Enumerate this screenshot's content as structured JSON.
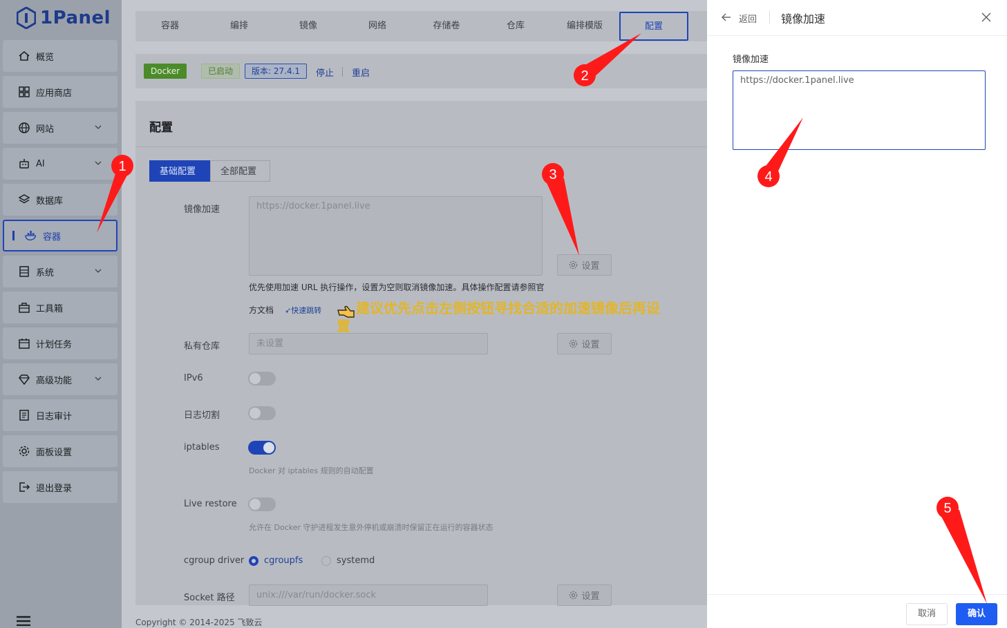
{
  "brand": {
    "name": "1Panel"
  },
  "sidebar": {
    "items": [
      {
        "label": "概览",
        "icon": "home-icon",
        "has_arrow": false
      },
      {
        "label": "应用商店",
        "icon": "apps-grid-icon",
        "has_arrow": false
      },
      {
        "label": "网站",
        "icon": "globe-icon",
        "has_arrow": true
      },
      {
        "label": "AI",
        "icon": "robot-icon",
        "has_arrow": true
      },
      {
        "label": "数据库",
        "icon": "layers-icon",
        "has_arrow": false
      },
      {
        "label": "容器",
        "icon": "docker-whale-icon",
        "has_arrow": false,
        "active": true
      },
      {
        "label": "系统",
        "icon": "server-icon",
        "has_arrow": true
      },
      {
        "label": "工具箱",
        "icon": "toolbox-icon",
        "has_arrow": false
      },
      {
        "label": "计划任务",
        "icon": "calendar-icon",
        "has_arrow": false
      },
      {
        "label": "高级功能",
        "icon": "diamond-icon",
        "has_arrow": true
      },
      {
        "label": "日志审计",
        "icon": "log-icon",
        "has_arrow": false
      },
      {
        "label": "面板设置",
        "icon": "gear-icon",
        "has_arrow": false
      },
      {
        "label": "退出登录",
        "icon": "logout-icon",
        "has_arrow": false
      }
    ]
  },
  "tabs": [
    {
      "label": "容器"
    },
    {
      "label": "编排"
    },
    {
      "label": "镜像"
    },
    {
      "label": "网络"
    },
    {
      "label": "存储卷"
    },
    {
      "label": "仓库"
    },
    {
      "label": "编排模版"
    },
    {
      "label": "配置",
      "active": true
    }
  ],
  "status": {
    "docker": "Docker",
    "running": "已启动",
    "version": "版本: 27.4.1",
    "stop": "停止",
    "restart": "重启"
  },
  "panel": {
    "title": "配置",
    "seg_basic": "基础配置",
    "seg_all": "全部配置",
    "mirror_label": "镜像加速",
    "mirror_value": "https://docker.1panel.live",
    "set_label": "设置",
    "mirror_help_1": "优先使用加速 URL 执行操作，设置为空则取消镜像加速。具体操作配置请参照官",
    "mirror_help_2": "方文档",
    "quick_link": "快速跳转",
    "registry_label": "私有仓库",
    "registry_value": "未设置",
    "ipv6_label": "IPv6",
    "logcut_label": "日志切割",
    "iptables_label": "iptables",
    "iptables_help": "Docker 对 iptables 规则的自动配置",
    "liverestore_label": "Live restore",
    "liverestore_help": "允许在 Docker 守护进程发生意外停机或崩溃时保留正在运行的容器状态",
    "cgroup_label": "cgroup driver",
    "cgroup_opt1": "cgroupfs",
    "cgroup_opt2": "systemd",
    "socket_label": "Socket 路径",
    "socket_value": "unix:///var/run/docker.sock"
  },
  "tip": "建议优先点击左侧按钮寻找合适的加速镜像后再设置",
  "copyright": "Copyright © 2014-2025 飞致云",
  "drawer": {
    "back": "返回",
    "title": "镜像加速",
    "field_label": "镜像加速",
    "field_value": "https://docker.1panel.live",
    "cancel": "取消",
    "confirm": "确认"
  },
  "markers": [
    "1",
    "2",
    "3",
    "4",
    "5"
  ],
  "colors": {
    "primary": "#1f44b7",
    "confirm": "#1f5cf2",
    "marker": "#ff1a1a",
    "tip": "#e2b52b"
  }
}
